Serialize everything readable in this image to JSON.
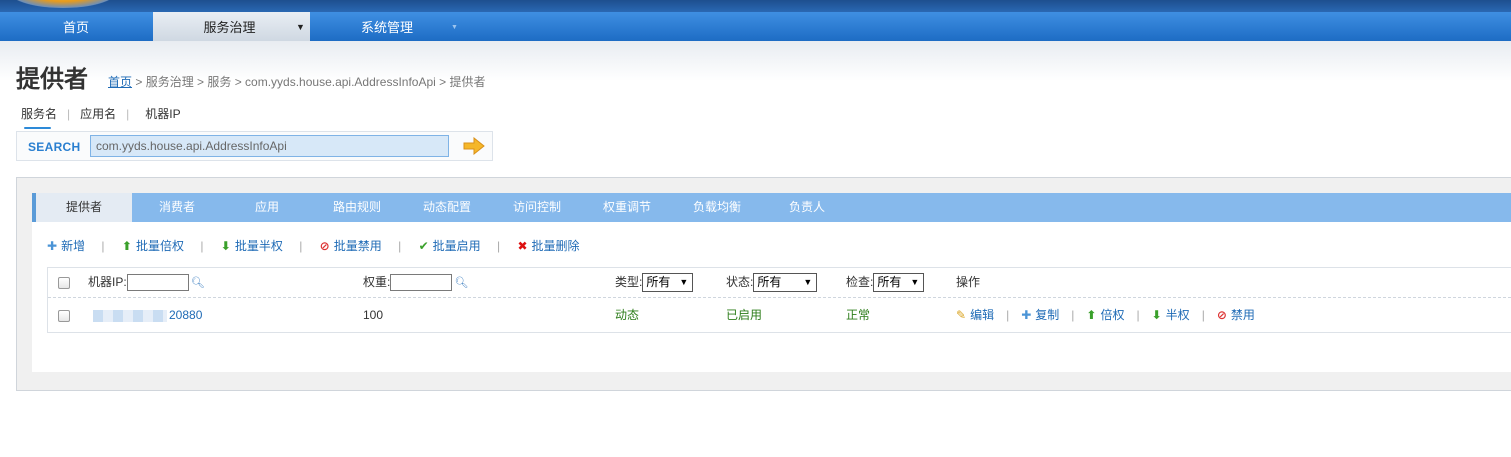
{
  "nav": {
    "items": [
      {
        "label": "首页"
      },
      {
        "label": "服务治理",
        "caret": "▼"
      },
      {
        "label": "系统管理",
        "caret": "▼"
      }
    ]
  },
  "page": {
    "title": "提供者",
    "breadcrumb": {
      "home": "首页",
      "trail": " > 服务治理 > 服务 > com.yyds.house.api.AddressInfoApi > 提供者"
    }
  },
  "search": {
    "tabs": [
      "服务名",
      "应用名",
      "机器IP"
    ],
    "active_tab": "服务名",
    "label": "SEARCH",
    "value": "com.yyds.house.api.AddressInfoApi"
  },
  "tabs": [
    "提供者",
    "消费者",
    "应用",
    "路由规则",
    "动态配置",
    "访问控制",
    "权重调节",
    "负载均衡",
    "负责人"
  ],
  "toolbar": {
    "add": "新增",
    "batch_double": "批量倍权",
    "batch_half": "批量半权",
    "batch_disable": "批量禁用",
    "batch_enable": "批量启用",
    "batch_delete": "批量删除"
  },
  "table": {
    "headers": {
      "ip": "机器IP:",
      "weight": "权重:",
      "type": "类型:",
      "status": "状态:",
      "check": "检查:",
      "ops": "操作"
    },
    "filters": {
      "type": "所有",
      "status": "所有",
      "check": "所有"
    },
    "rows": [
      {
        "ip_port": "20880",
        "weight": "100",
        "type": "动态",
        "status": "已启用",
        "check": "正常",
        "ops": {
          "edit": "编辑",
          "copy": "复制",
          "double": "倍权",
          "half": "半权",
          "disable": "禁用"
        }
      }
    ]
  }
}
